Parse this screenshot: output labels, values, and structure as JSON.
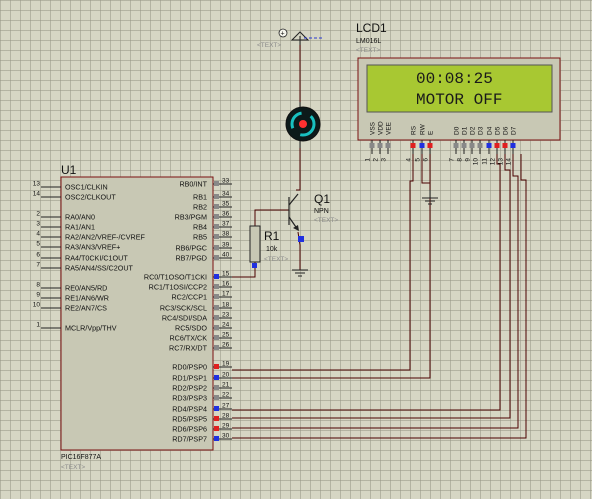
{
  "mcu": {
    "designator": "U1",
    "part": "PIC16F877A",
    "text_placeholder": "<TEXT>",
    "left_pins": [
      {
        "num": "13",
        "label": "OSC1/CLKIN"
      },
      {
        "num": "14",
        "label": "OSC2/CLKOUT"
      },
      {
        "num": "2",
        "label": "RA0/AN0"
      },
      {
        "num": "3",
        "label": "RA1/AN1"
      },
      {
        "num": "4",
        "label": "RA2/AN2/VREF-/CVREF"
      },
      {
        "num": "5",
        "label": "RA3/AN3/VREF+"
      },
      {
        "num": "6",
        "label": "RA4/T0CKI/C1OUT"
      },
      {
        "num": "7",
        "label": "RA5/AN4/SS/C2OUT"
      },
      {
        "num": "8",
        "label": "RE0/AN5/RD"
      },
      {
        "num": "9",
        "label": "RE1/AN6/WR"
      },
      {
        "num": "10",
        "label": "RE2/AN7/CS"
      },
      {
        "num": "1",
        "label": "MCLR/Vpp/THV"
      }
    ],
    "right_pins": [
      {
        "num": "33",
        "label": "RB0/INT"
      },
      {
        "num": "34",
        "label": "RB1"
      },
      {
        "num": "35",
        "label": "RB2"
      },
      {
        "num": "36",
        "label": "RB3/PGM"
      },
      {
        "num": "37",
        "label": "RB4"
      },
      {
        "num": "38",
        "label": "RB5"
      },
      {
        "num": "39",
        "label": "RB6/PGC"
      },
      {
        "num": "40",
        "label": "RB7/PGD"
      },
      {
        "num": "15",
        "label": "RC0/T1OSO/T1CKI"
      },
      {
        "num": "16",
        "label": "RC1/T1OSI/CCP2"
      },
      {
        "num": "17",
        "label": "RC2/CCP1"
      },
      {
        "num": "18",
        "label": "RC3/SCK/SCL"
      },
      {
        "num": "23",
        "label": "RC4/SDI/SDA"
      },
      {
        "num": "24",
        "label": "RC5/SDO"
      },
      {
        "num": "25",
        "label": "RC6/TX/CK"
      },
      {
        "num": "26",
        "label": "RC7/RX/DT"
      },
      {
        "num": "19",
        "label": "RD0/PSP0"
      },
      {
        "num": "20",
        "label": "RD1/PSP1"
      },
      {
        "num": "21",
        "label": "RD2/PSP2"
      },
      {
        "num": "22",
        "label": "RD3/PSP3"
      },
      {
        "num": "27",
        "label": "RD4/PSP4"
      },
      {
        "num": "28",
        "label": "RD5/PSP5"
      },
      {
        "num": "29",
        "label": "RD6/PSP6"
      },
      {
        "num": "30",
        "label": "RD7/PSP7"
      }
    ]
  },
  "lcd": {
    "designator": "LCD1",
    "part": "LM016L",
    "text_placeholder": "<TEXT>",
    "line1": "00:08:25",
    "line2": "MOTOR OFF",
    "pins": [
      {
        "name": "VSS",
        "num": "1"
      },
      {
        "name": "VDD",
        "num": "2"
      },
      {
        "name": "VEE",
        "num": "3"
      },
      {
        "name": "RS",
        "num": "4"
      },
      {
        "name": "RW",
        "num": "5"
      },
      {
        "name": "E",
        "num": "6"
      },
      {
        "name": "D0",
        "num": "7"
      },
      {
        "name": "D1",
        "num": "8"
      },
      {
        "name": "D2",
        "num": "9"
      },
      {
        "name": "D3",
        "num": "10"
      },
      {
        "name": "D4",
        "num": "11"
      },
      {
        "name": "D5",
        "num": "12"
      },
      {
        "name": "D6",
        "num": "13"
      },
      {
        "name": "D7",
        "num": "14"
      }
    ]
  },
  "transistor": {
    "designator": "Q1",
    "part": "NPN",
    "text_placeholder": "<TEXT>"
  },
  "resistor": {
    "designator": "R1",
    "value": "10k",
    "text_placeholder": "<TEXT>"
  },
  "power": {
    "text_placeholder": "<TEXT>"
  },
  "colors": {
    "lcd_screen": "#a8c832",
    "pin_active": "#e02020",
    "pin_low": "#2030e0",
    "component_fill": "#c8c8b4",
    "wire": "#3a0000"
  }
}
